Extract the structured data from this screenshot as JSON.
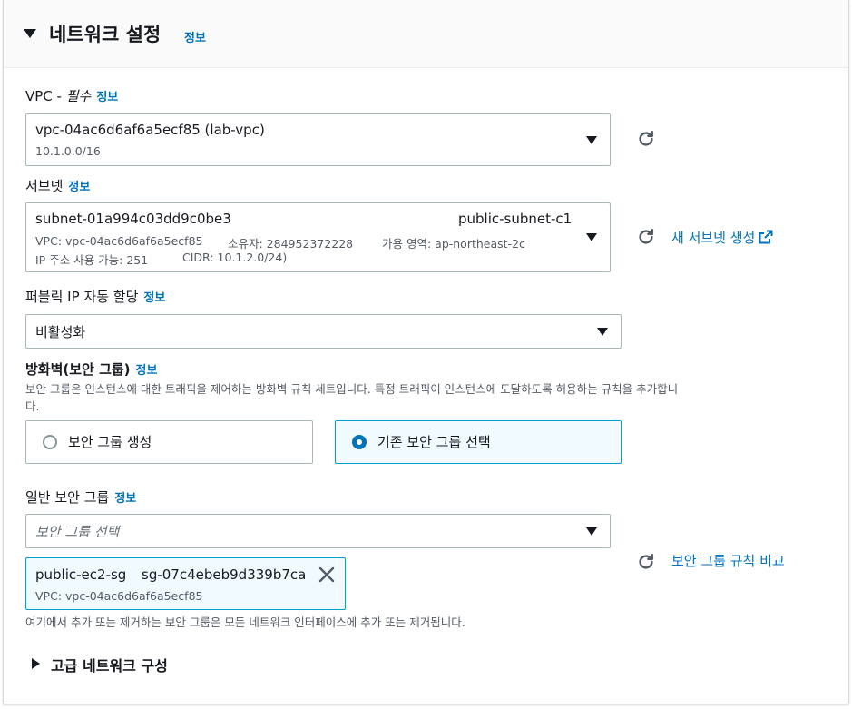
{
  "section": {
    "title": "네트워크 설정",
    "info": "정보"
  },
  "vpc": {
    "label": "VPC - ",
    "required": "필수",
    "info": "정보",
    "value": "vpc-04ac6d6af6a5ecf85 (lab-vpc)",
    "cidr": "10.1.0.0/16"
  },
  "subnet": {
    "label": "서브넷",
    "info": "정보",
    "id": "subnet-01a994c03dd9c0be3",
    "name": "public-subnet-c1",
    "vpc": "VPC: vpc-04ac6d6af6a5ecf85",
    "owner": "소유자: 284952372228",
    "az": "가용 영역: ap-northeast-2c",
    "ip_available": "IP 주소 사용 가능: 251",
    "cidr": "CIDR: 10.1.2.0/24)",
    "create_link": "새 서브넷 생성"
  },
  "public_ip": {
    "label": "퍼블릭 IP 자동 할당",
    "info": "정보",
    "value": "비활성화"
  },
  "firewall": {
    "label": "방화벽(보안 그룹)",
    "info": "정보",
    "description_line1": "보안 그룹은 인스턴스에 대한 트래픽을 제어하는 방화벽 규칙 세트입니다. 특정 트래픽이 인스턴스에 도달하도록 허용하는 규칙을 추가합니",
    "description_line2": "다.",
    "option_create": "보안 그룹 생성",
    "option_existing": "기존 보안 그룹 선택",
    "selected_option": "existing"
  },
  "common_sg": {
    "label": "일반 보안 그룹",
    "info": "정보",
    "placeholder": "보안 그룹 선택",
    "compare_link": "보안 그룹 규칙 비교",
    "token": {
      "name": "public-ec2-sg",
      "id": "sg-07c4ebeb9d339b7ca",
      "vpc": "VPC: vpc-04ac6d6af6a5ecf85"
    },
    "note": "여기에서 추가 또는 제거하는 보안 그룹은 모든 네트워크 인터페이스에 추가 또는 제거됩니다."
  },
  "advanced": {
    "label": "고급 네트워크 구성"
  },
  "colors": {
    "link": "#0073bb",
    "selected_border": "#00a1c9",
    "selected_bg": "#f1faff",
    "header_bg": "#fafafa"
  }
}
